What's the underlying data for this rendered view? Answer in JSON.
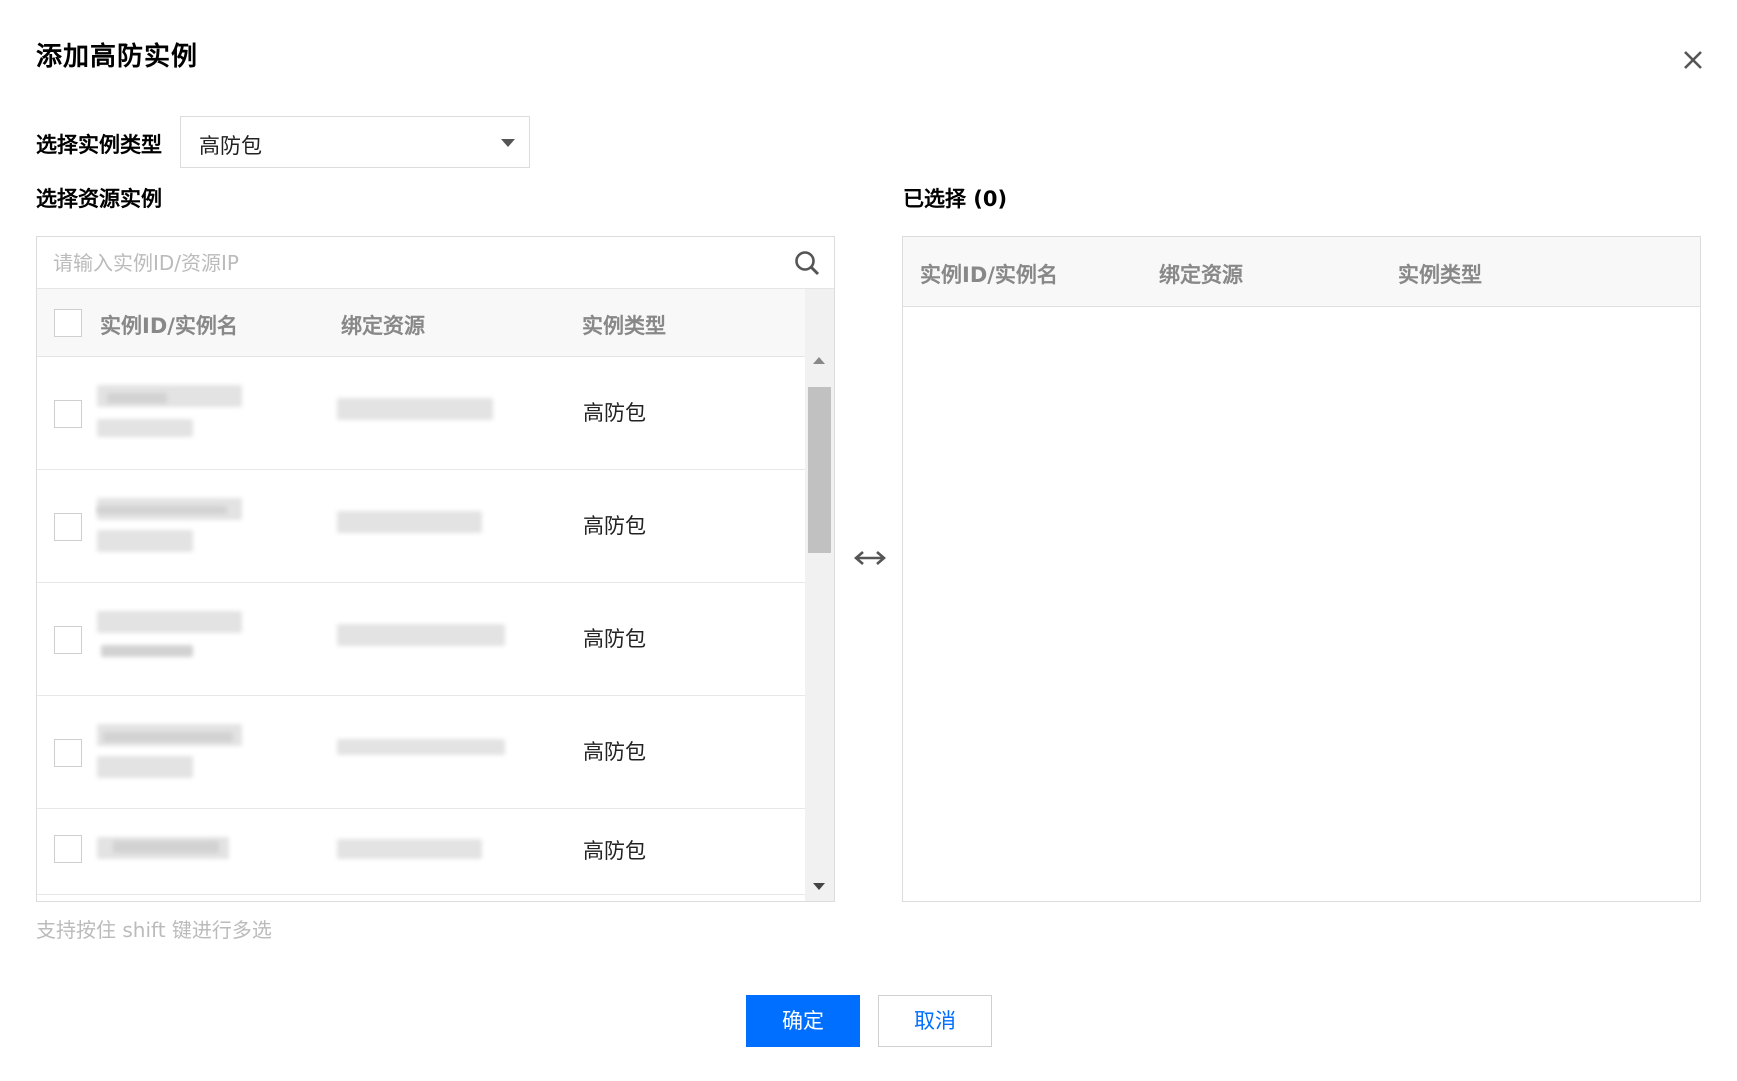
{
  "dialog": {
    "title": "添加高防实例",
    "instance_type_label": "选择实例类型",
    "instance_type_value": "高防包",
    "source_label": "选择资源实例",
    "selected_label": "已选择 (0)"
  },
  "search": {
    "placeholder": "请输入实例ID/资源IP"
  },
  "table": {
    "columns": [
      "实例ID/实例名",
      "绑定资源",
      "实例类型"
    ],
    "rows": [
      {
        "type": "高防包"
      },
      {
        "type": "高防包"
      },
      {
        "type": "高防包"
      },
      {
        "type": "高防包"
      },
      {
        "type": "高防包"
      }
    ]
  },
  "selected_table": {
    "columns": [
      "实例ID/实例名",
      "绑定资源",
      "实例类型"
    ]
  },
  "hint": "支持按住 shift 键进行多选",
  "footer": {
    "confirm": "确定",
    "cancel": "取消"
  },
  "colors": {
    "primary": "#006eff",
    "border": "#dcdcdc",
    "header_bg": "#f8f8f8"
  },
  "icons": [
    "close-icon",
    "search-icon",
    "swap-arrow-icon",
    "chevron-down-icon"
  ]
}
